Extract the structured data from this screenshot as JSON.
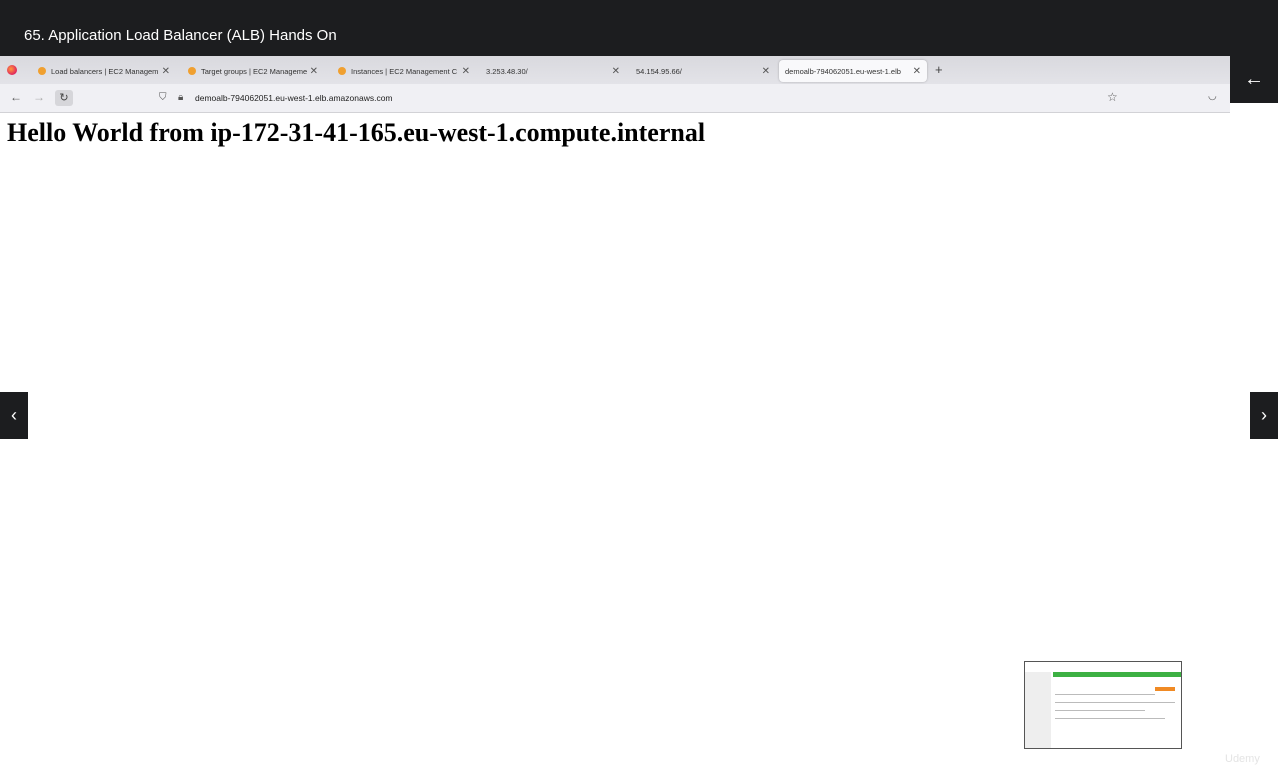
{
  "course": {
    "lecture_title": "65. Application Load Balancer (ALB) Hands On"
  },
  "browser": {
    "tabs": [
      {
        "label": "Load balancers | EC2 Managem",
        "has_favicon": true
      },
      {
        "label": "Target groups | EC2 Manageme",
        "has_favicon": true
      },
      {
        "label": "Instances | EC2 Management C",
        "has_favicon": true
      },
      {
        "label": "3.253.48.30/",
        "has_favicon": false
      },
      {
        "label": "54.154.95.66/",
        "has_favicon": false
      },
      {
        "label": "demoalb-794062051.eu-west-1.elb",
        "has_favicon": false,
        "active": true
      }
    ],
    "tab_close_glyph": "✕",
    "new_tab_glyph": "+",
    "url": "demoalb-794062051.eu-west-1.elb.amazonaws.com",
    "icons": [
      "firefox-icon",
      "back-icon",
      "forward-icon",
      "reload-icon",
      "shield-icon",
      "lock-icon",
      "star-icon",
      "pocket-icon"
    ]
  },
  "page": {
    "heading": "Hello World from ip-172-31-41-165.eu-west-1.compute.internal"
  },
  "player": {
    "watermark": "Udemy",
    "glyphs": {
      "back": "←",
      "prev": "‹",
      "next": "›"
    }
  },
  "colors": {
    "header_bg": "#1c1d1f",
    "accent_green": "#3cb043",
    "accent_orange": "#f08a24"
  }
}
